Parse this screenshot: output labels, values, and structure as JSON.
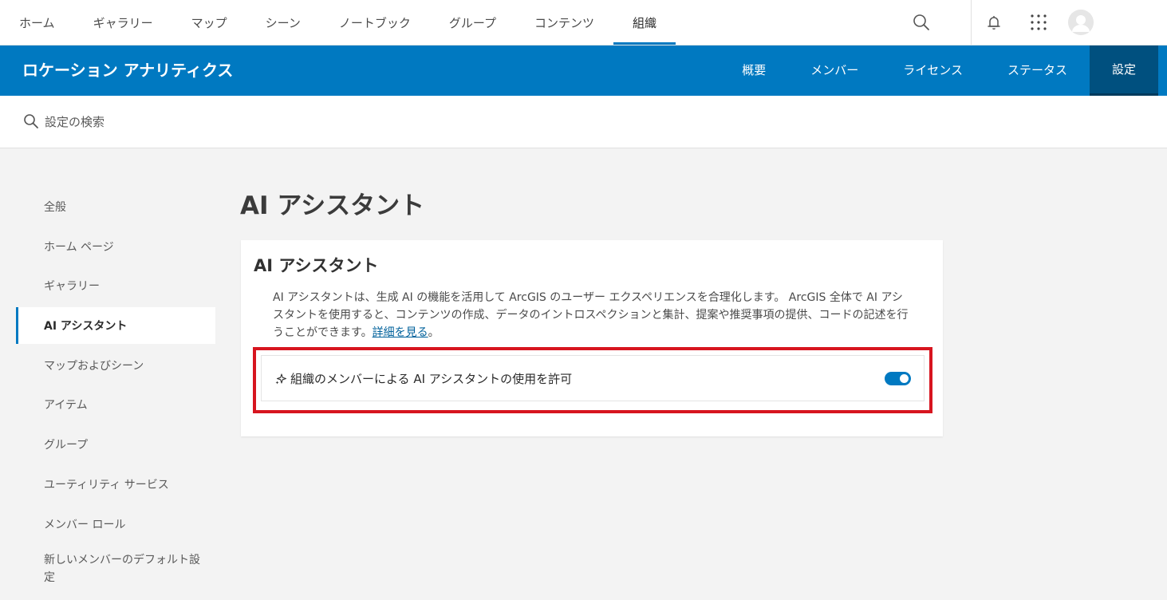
{
  "topnav": {
    "links": [
      "ホーム",
      "ギャラリー",
      "マップ",
      "シーン",
      "ノートブック",
      "グループ",
      "コンテンツ",
      "組織"
    ],
    "active_index": 7,
    "icons": [
      "search-icon",
      "bell-icon",
      "apps-grid-icon",
      "avatar"
    ]
  },
  "orgbar": {
    "title": "ロケーション アナリティクス",
    "tabs": [
      "概要",
      "メンバー",
      "ライセンス",
      "ステータス",
      "設定"
    ],
    "active_index": 4
  },
  "search": {
    "placeholder": "設定の検索"
  },
  "sidebar": {
    "items": [
      "全般",
      "ホーム ページ",
      "ギャラリー",
      "AI アシスタント",
      "マップおよびシーン",
      "アイテム",
      "グループ",
      "ユーティリティ サービス",
      "メンバー ロール",
      "新しいメンバーのデフォルト設定"
    ],
    "active_index": 3
  },
  "main": {
    "page_title": "AI アシスタント",
    "card": {
      "title": "AI アシスタント",
      "description": "AI アシスタントは、生成 AI の機能を活用して ArcGIS のユーザー エクスペリエンスを合理化します。 ArcGIS 全体で AI アシスタントを使用すると、コンテンツの作成、データのイントロスペクションと集計、提案や推奨事項の提供、コードの記述を行うことができます。",
      "link": "詳細を見る",
      "link_suffix": "。",
      "setting_label": "組織のメンバーによる AI アシスタントの使用を許可",
      "setting_enabled": true
    }
  },
  "colors": {
    "brand": "#0079c1",
    "brand_dark": "#00507f",
    "highlight": "#d7151f"
  }
}
